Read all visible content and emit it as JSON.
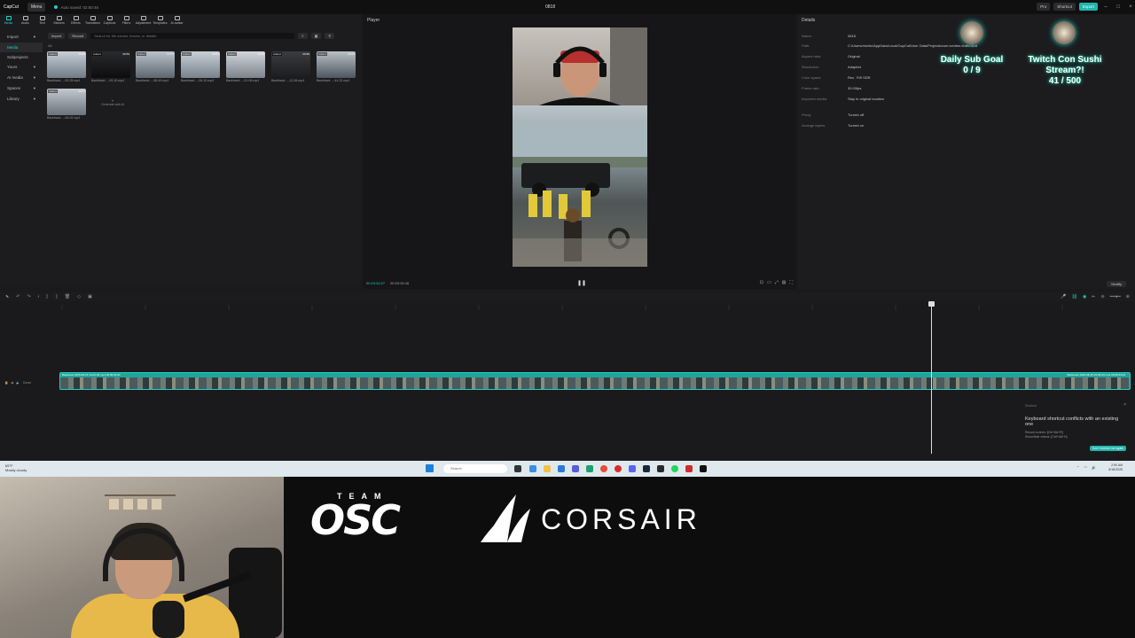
{
  "titlebar": {
    "logo": "CapCut",
    "menu": "Menu",
    "autosave": "Auto saved: 02:50:46",
    "project": "0818",
    "pro": "Pro",
    "shortcut": "Shortcut",
    "export": "Export"
  },
  "tools": [
    {
      "label": "Media"
    },
    {
      "label": "Audio"
    },
    {
      "label": "Text"
    },
    {
      "label": "Stickers"
    },
    {
      "label": "Effects"
    },
    {
      "label": "Transitions"
    },
    {
      "label": "Captions"
    },
    {
      "label": "Filters"
    },
    {
      "label": "Adjustment"
    },
    {
      "label": "Templates"
    },
    {
      "label": "AI avatar"
    }
  ],
  "sidebar": {
    "items": [
      {
        "label": "Import"
      },
      {
        "label": "Media"
      },
      {
        "label": "Subprojects"
      },
      {
        "label": "Yours"
      },
      {
        "label": "AI media"
      },
      {
        "label": "Spaces"
      },
      {
        "label": "Library"
      }
    ]
  },
  "media": {
    "import": "Import",
    "record": "Record",
    "search_placeholder": "Search for file names, leaves, or details",
    "all": "All",
    "generate": "Generate with AI",
    "clips": [
      {
        "tag": "Added",
        "dur": "10:00",
        "name": "Backtrack ...-00-25.mp4"
      },
      {
        "tag": "Added",
        "dur": "09:59",
        "name": "Backtrack ...-09-10.mp4"
      },
      {
        "tag": "Added",
        "dur": "07:57",
        "name": "Backtrack ...-58-49.mp4"
      },
      {
        "tag": "Added",
        "dur": "09:57",
        "name": "Backtrack ...-06-20.mp4"
      },
      {
        "tag": "Added",
        "dur": "10:00",
        "name": "Backtrack ...-01-06.mp4"
      },
      {
        "tag": "Added",
        "dur": "09:59",
        "name": "Backtrack ...-12-06.mp4"
      },
      {
        "tag": "Added",
        "dur": "09:57",
        "name": "Backtrack ...-44-22.mp4"
      },
      {
        "tag": "Added",
        "dur": "09:57",
        "name": "Backtrack ...-06-02.mp4"
      }
    ]
  },
  "player": {
    "header": "Player",
    "time_current": "00:10:24:27",
    "time_total": "00:23:30:16"
  },
  "details": {
    "header": "Details",
    "modify": "Modify",
    "rows": [
      {
        "k": "Name:",
        "v": "0818"
      },
      {
        "k": "Path:",
        "v": "C:/Users/michic/AppData/Local/CapCut/User Data/Projects/com.lveditor.draft/0818"
      },
      {
        "k": "Aspect ratio:",
        "v": "Original"
      },
      {
        "k": "Resolution:",
        "v": "Adapted"
      },
      {
        "k": "Color space:",
        "v": "Rec. 709 SDR"
      },
      {
        "k": "Frame rate:",
        "v": "30.00fps"
      },
      {
        "k": "Imported media:",
        "v": "Stay in original location"
      },
      {
        "k": "Proxy:",
        "v": "Turned off"
      },
      {
        "k": "Arrange layers:",
        "v": "Turned on"
      }
    ]
  },
  "overlay": {
    "sub_goal_title": "Daily Sub Goal",
    "sub_goal_value": "0 / 9",
    "stream_title1": "Twitch Con Sushi",
    "stream_title2": "Stream?!",
    "stream_value": "41 / 500"
  },
  "timeline": {
    "clip_label_left": "Backtrack 2025-08-15 19-00-35.mp4  00:09:54:03",
    "clip_label_right": "Backtrack 2025-08-15 23-56-23.mp4  00:09:54:03",
    "cover": "Cover"
  },
  "toast": {
    "title": "Shortcut",
    "message": "Keyboard shortcut conflicts with an existing one",
    "line1": "Record screen: [Ctrl+Alt+R]",
    "line2": "Show/hide videos: [Ctrl+Alt+H]",
    "button": "Don't remind me again"
  },
  "taskbar": {
    "temp": "65°F",
    "weather": "Mostly cloudy",
    "search": "Search",
    "time": "2:50 AM",
    "date": "8/18/2025"
  },
  "sponsor": {
    "team": "TEAM",
    "osc": "OSC",
    "corsair": "CORSAIR"
  },
  "colors": {
    "accent": "#1fd1c6",
    "panel": "#1c1c1e"
  }
}
